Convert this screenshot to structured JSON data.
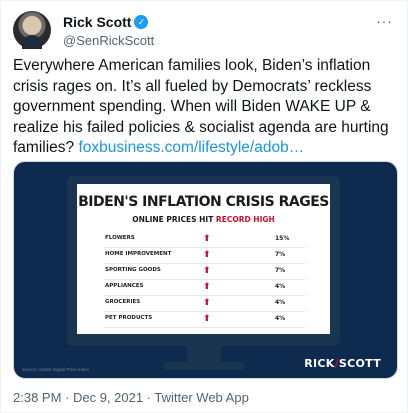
{
  "tweet": {
    "author": {
      "display_name": "Rick Scott",
      "handle": "@SenRickScott",
      "verified_mark": "✓",
      "avatar": "avatar-photo",
      "more_label": "···"
    },
    "text": "Everywhere American families look, Biden’s inflation crisis rages on. It’s all fueled by Democrats’ reckless government spending. When will Biden WAKE UP & realize his failed policies & socialist agenda are hurting families?",
    "link": "foxbusiness.com/lifestyle/adob…",
    "footer": "2:38 PM · Dec 9, 2021 · Twitter Web App"
  },
  "graphic": {
    "title": "BIDEN'S INFLATION CRISIS RAGES",
    "subtitle_prefix": "ONLINE PRICES HIT ",
    "subtitle_highlight": "RECORD HIGH",
    "source": "Source: Adobe Digital Price Index",
    "brand_left": "RICK",
    "brand_slash": "/",
    "brand_right": "SCOTT",
    "arrow": "⬆",
    "colors": {
      "background": "#0f2a4f",
      "accent": "#c8102e",
      "link": "#1b95e0",
      "verified": "#1d9bf0"
    }
  },
  "chart_data": {
    "type": "table",
    "title": "BIDEN'S INFLATION CRISIS RAGES",
    "subtitle": "ONLINE PRICES HIT RECORD HIGH",
    "columns": [
      "category",
      "change"
    ],
    "rows": [
      {
        "category": "FLOWERS",
        "change": "15%"
      },
      {
        "category": "HOME IMPROVEMENT",
        "change": "7%"
      },
      {
        "category": "SPORTING GOODS",
        "change": "7%"
      },
      {
        "category": "APPLIANCES",
        "change": "4%"
      },
      {
        "category": "GROCERIES",
        "change": "4%"
      },
      {
        "category": "PET PRODUCTS",
        "change": "4%"
      }
    ]
  }
}
